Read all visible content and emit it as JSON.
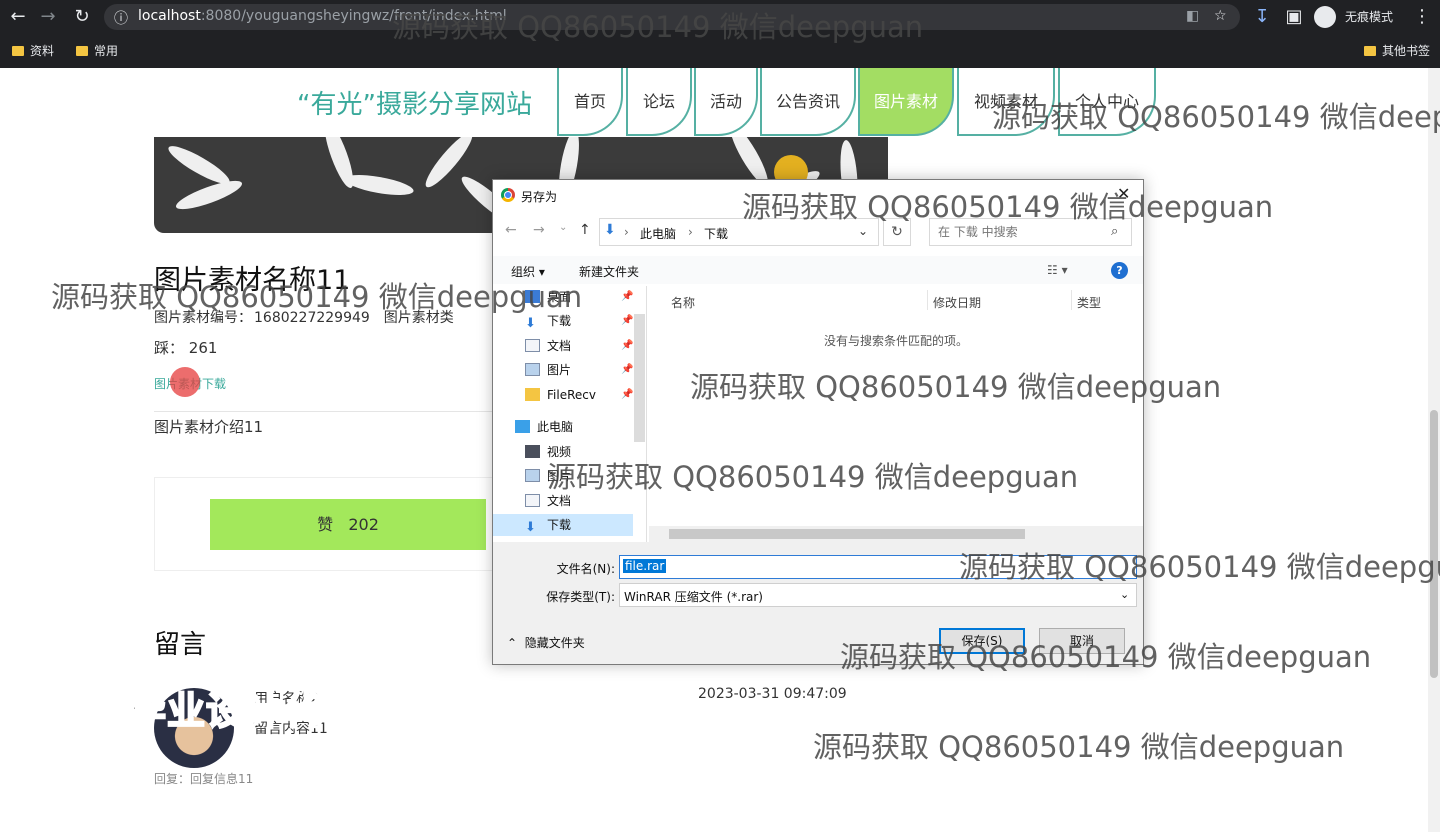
{
  "browser": {
    "url_host": "localhost",
    "url_path": ":8080/youguangsheyingwz/front/index.html",
    "incognito_label": "无痕模式",
    "bookmarks": [
      "资料",
      "常用"
    ],
    "other_bookmarks": "其他书签"
  },
  "site": {
    "title": "“有光”摄影分享网站",
    "nav": [
      "首页",
      "论坛",
      "活动",
      "公告资讯",
      "图片素材",
      "视频素材",
      "个人中心"
    ],
    "active_nav": "图片素材"
  },
  "item": {
    "name": "图片素材名称11",
    "code_label": "图片素材编号：",
    "code_value": "1680227229949",
    "type_label": "图片素材类",
    "cai_label": "踩：",
    "cai_value": "261",
    "download_link": "图片素材下载",
    "intro": "图片素材介绍11",
    "like_label": "赞",
    "like_count": "202"
  },
  "comments": {
    "title": "留言",
    "user": "用户名称2",
    "content": "留言内容11",
    "time": "2023-03-31 09:47:09",
    "reply": "回复：回复信息11"
  },
  "overlay_stamp": "专业毕业设计代做",
  "dialog": {
    "title": "另存为",
    "breadcrumb": [
      "此电脑",
      "下载"
    ],
    "search_placeholder": "在 下载 中搜索",
    "toolbar": {
      "organize": "组织",
      "new_folder": "新建文件夹"
    },
    "nav_items": [
      {
        "label": "桌面",
        "pinned": true
      },
      {
        "label": "下载",
        "pinned": true
      },
      {
        "label": "文档",
        "pinned": true
      },
      {
        "label": "图片",
        "pinned": true
      },
      {
        "label": "FileRecv",
        "pinned": true
      },
      {
        "label": "此电脑",
        "pinned": false
      },
      {
        "label": "视频",
        "pinned": false
      },
      {
        "label": "图片",
        "pinned": false
      },
      {
        "label": "文档",
        "pinned": false
      },
      {
        "label": "下载",
        "pinned": false,
        "selected": true
      }
    ],
    "columns": [
      "名称",
      "修改日期",
      "类型"
    ],
    "empty_message": "没有与搜索条件匹配的项。",
    "filename_label": "文件名(N):",
    "filename_value": "file.rar",
    "filetype_label": "保存类型(T):",
    "filetype_value": "WinRAR 压缩文件 (*.rar)",
    "hide_folders": "隐藏文件夹",
    "save_button": "保存(S)",
    "cancel_button": "取消"
  },
  "watermark": "源码获取 QQ86050149 微信deepguan"
}
